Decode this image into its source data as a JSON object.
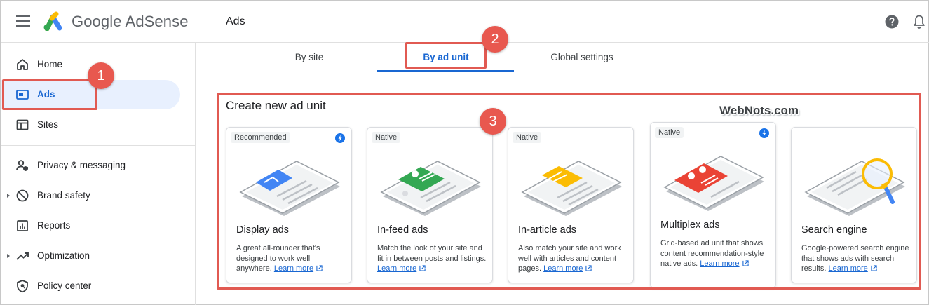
{
  "header": {
    "logo_text": "Google AdSense",
    "page_title": "Ads"
  },
  "sidebar": {
    "items": [
      {
        "label": "Home",
        "icon": "home-icon"
      },
      {
        "label": "Ads",
        "icon": "ads-icon",
        "active": true
      },
      {
        "label": "Sites",
        "icon": "sites-icon"
      },
      {
        "label": "Privacy & messaging",
        "icon": "privacy-icon"
      },
      {
        "label": "Brand safety",
        "icon": "block-icon"
      },
      {
        "label": "Reports",
        "icon": "reports-icon"
      },
      {
        "label": "Optimization",
        "icon": "trending-icon"
      },
      {
        "label": "Policy center",
        "icon": "shield-icon"
      }
    ]
  },
  "tabs": [
    {
      "label": "By site"
    },
    {
      "label": "By ad unit",
      "active": true
    },
    {
      "label": "Global settings"
    }
  ],
  "section": {
    "title": "Create new ad unit",
    "watermark": "WebNots.com"
  },
  "cards": [
    {
      "badge": "Recommended",
      "title": "Display ads",
      "desc": "A great all-rounder that's designed to work well anywhere.",
      "learn_more": "Learn more",
      "accent": "#4285f4"
    },
    {
      "badge": "Native",
      "title": "In-feed ads",
      "desc": "Match the look of your site and fit in between posts and listings.",
      "learn_more": "Learn more",
      "accent": "#34a853"
    },
    {
      "badge": "Native",
      "title": "In-article ads",
      "desc": "Also match your site and work well with articles and content pages.",
      "learn_more": "Learn more",
      "accent": "#fbbc04"
    },
    {
      "badge": "Native",
      "title": "Multiplex ads",
      "desc": "Grid-based ad unit that shows content recommendation-style native ads.",
      "learn_more": "Learn more",
      "accent": "#ea4335"
    },
    {
      "badge": "",
      "title": "Search engine",
      "desc": "Google-powered search engine that shows ads with search results.",
      "learn_more": "Learn more",
      "accent": "#fbbc04"
    }
  ],
  "annotations": [
    "1",
    "2",
    "3"
  ],
  "colors": {
    "brand_blue": "#1967d2",
    "active_bg": "#e8f0fe",
    "annotation_red": "#e8584f"
  }
}
